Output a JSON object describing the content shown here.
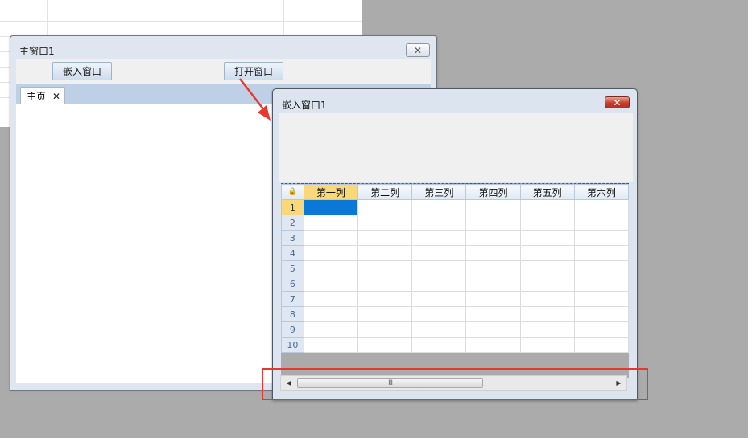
{
  "main_window": {
    "title": "主窗口1",
    "close_icon": "close-icon",
    "close_glyph": "✕",
    "toolbar": {
      "embed_button": "嵌入窗口",
      "open_button": "打开窗口"
    },
    "tabs": [
      {
        "label": "主页",
        "close_glyph": "✕"
      }
    ]
  },
  "embedded_window": {
    "title": "嵌入窗口1",
    "close_glyph": "✕",
    "grid": {
      "corner_glyph": "🔒",
      "columns": [
        "第一列",
        "第二列",
        "第三列",
        "第四列",
        "第五列",
        "第六列"
      ],
      "rows": [
        "1",
        "2",
        "3",
        "4",
        "5",
        "6",
        "7",
        "8",
        "9",
        "10"
      ],
      "selected_row": "1",
      "selected_column": "第一列"
    },
    "scrollbar": {
      "left_glyph": "◀",
      "right_glyph": "▶",
      "thumb_grip": "III"
    }
  },
  "annotation": {
    "arrow_color": "#e8372c",
    "box_color": "#e8372c"
  }
}
